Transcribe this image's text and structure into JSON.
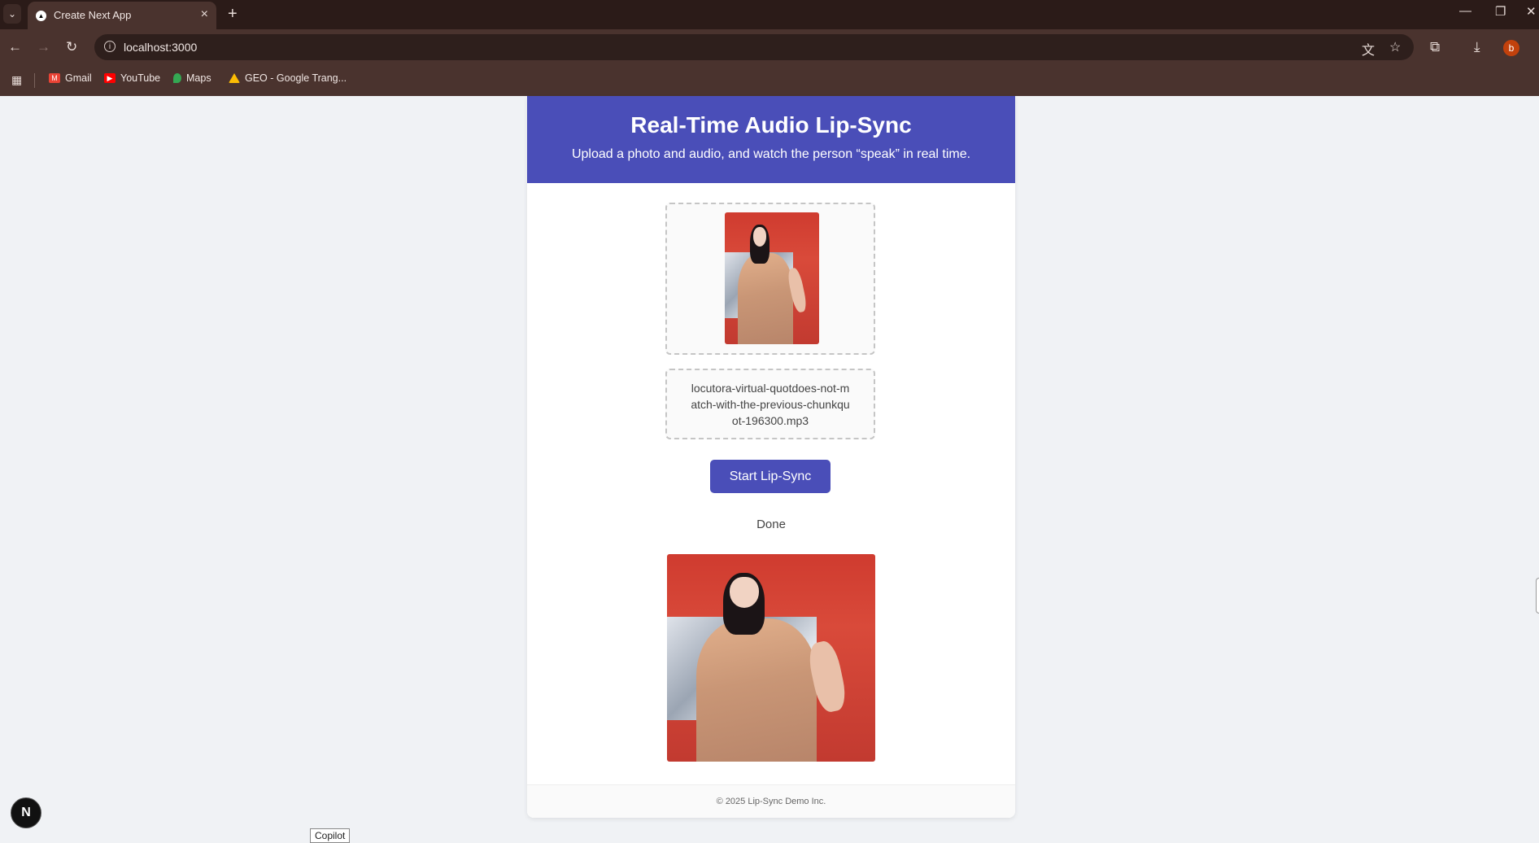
{
  "browser": {
    "tab_title": "Create Next App",
    "url": "localhost:3000",
    "profile_initial": "b",
    "bookmarks": [
      {
        "label": "Gmail",
        "color": "#ea4335",
        "icon": "gmail-icon"
      },
      {
        "label": "YouTube",
        "color": "#ff0000",
        "icon": "youtube-icon"
      },
      {
        "label": "Maps",
        "color": "#34a853",
        "icon": "maps-icon"
      },
      {
        "label": "GEO - Google Trang...",
        "color": "#fbbc04",
        "icon": "drive-icon"
      }
    ]
  },
  "header": {
    "title": "Real-Time Audio Lip-Sync",
    "subtitle": "Upload a photo and audio, and watch the person “speak” in real time."
  },
  "upload": {
    "audio_filename": "locutora-virtual-quotdoes-not-match-with-the-previous-chunkquot-196300.mp3"
  },
  "actions": {
    "start_label": "Start Lip-Sync"
  },
  "status": {
    "text": "Done"
  },
  "footer": {
    "text": "© 2025 Lip-Sync Demo Inc."
  },
  "overlays": {
    "next_badge": "N",
    "copilot_tooltip": "Copilot"
  },
  "colors": {
    "accent": "#4a4eb8",
    "chrome_bg": "#4a332e",
    "page_bg": "#f0f2f5"
  }
}
